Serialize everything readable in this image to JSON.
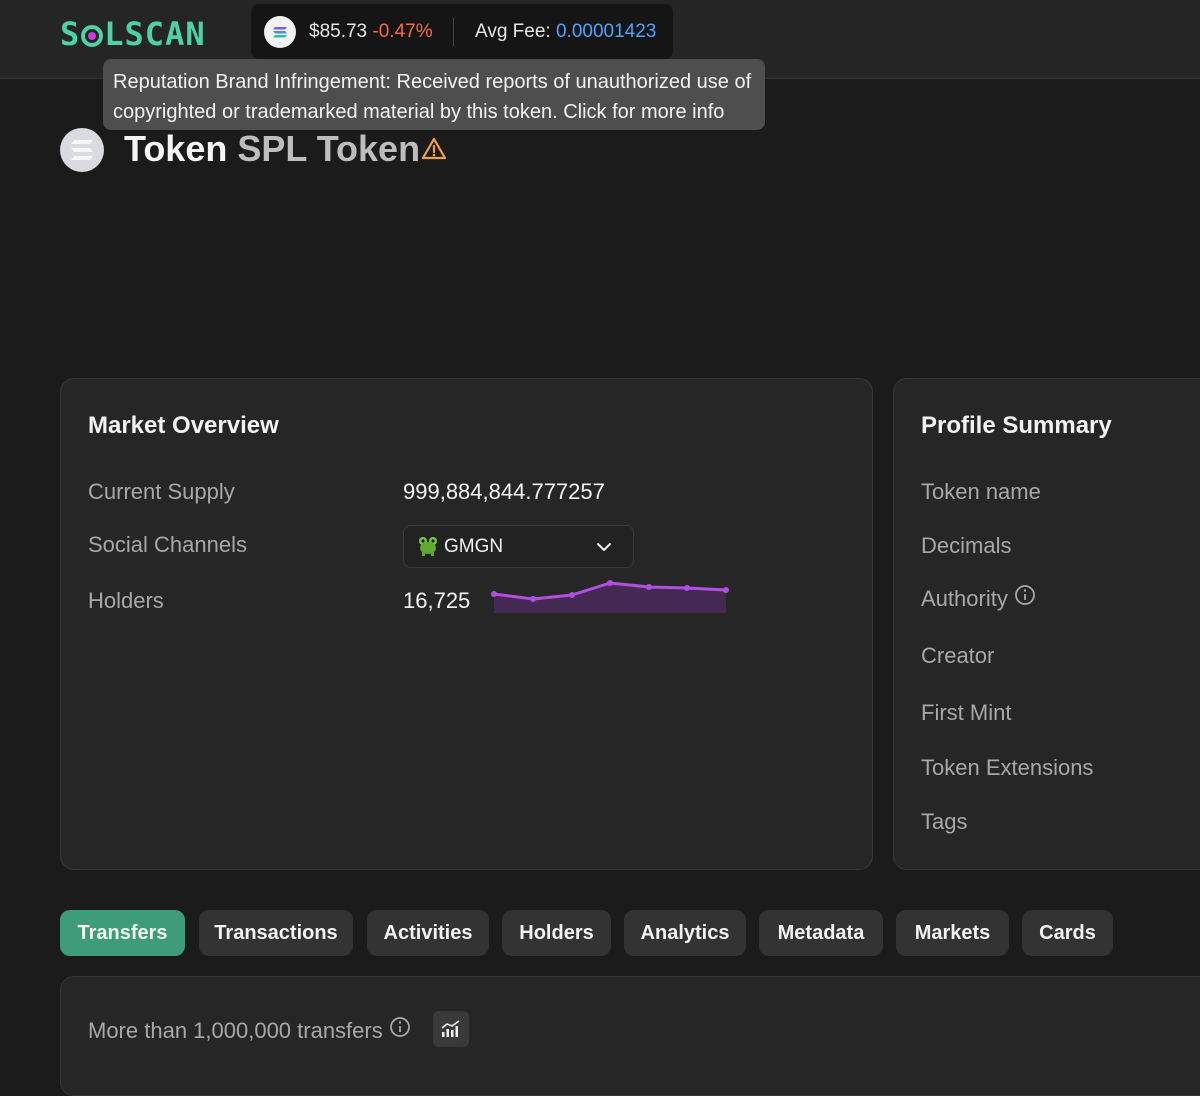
{
  "header": {
    "logo_text": "SOLSCAN",
    "sol_price": "$85.73",
    "sol_change": "-0.47%",
    "avg_fee_label": "Avg Fee:",
    "avg_fee_value": "0.00001423",
    "colors": {
      "brand": "#4fd1a6",
      "negative": "#ff6a3d",
      "link": "#4ea3ff"
    }
  },
  "tooltip": {
    "text": "Reputation Brand Infringement: Received reports of unauthorized use of copyrighted or trademarked material by this token. Click for more info"
  },
  "token": {
    "name": "Token",
    "subtitle": "SPL Token",
    "warning_icon": "warning-triangle-icon"
  },
  "market_overview": {
    "title": "Market Overview",
    "current_supply_label": "Current Supply",
    "current_supply_value": "999,884,844.777257",
    "social_channels_label": "Social Channels",
    "social_channel_selected": "GMGN",
    "holders_label": "Holders",
    "holders_value": "16,725",
    "holders_trend_color": "#b04fe0"
  },
  "profile_summary": {
    "title": "Profile Summary",
    "labels": [
      "Token name",
      "Decimals",
      "Authority",
      "Creator",
      "First Mint",
      "Token Extensions",
      "Tags"
    ]
  },
  "tabs": [
    {
      "label": "Transfers",
      "active": true
    },
    {
      "label": "Transactions",
      "active": false
    },
    {
      "label": "Activities",
      "active": false
    },
    {
      "label": "Holders",
      "active": false
    },
    {
      "label": "Analytics",
      "active": false
    },
    {
      "label": "Metadata",
      "active": false
    },
    {
      "label": "Markets",
      "active": false
    },
    {
      "label": "Cards",
      "active": false
    }
  ],
  "transfers": {
    "count_text": "More than 1,000,000 transfers"
  }
}
